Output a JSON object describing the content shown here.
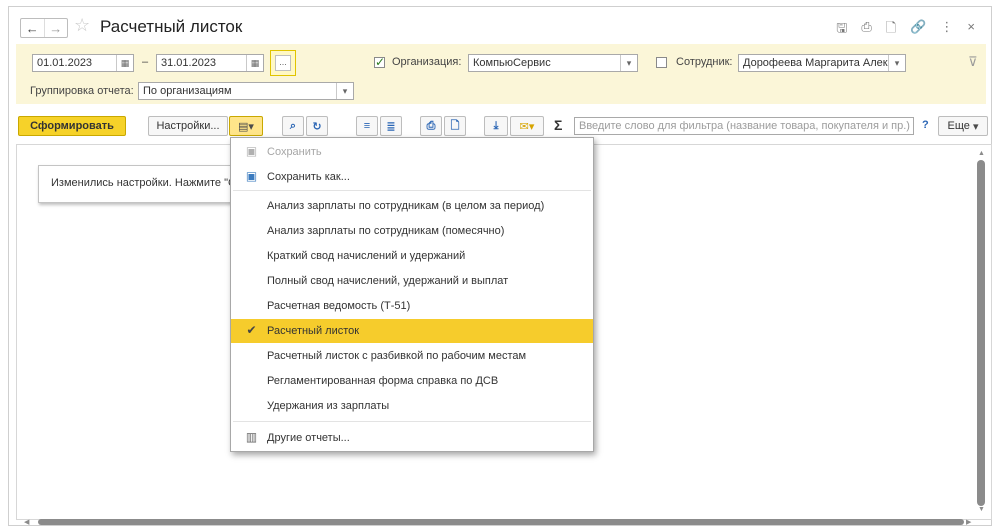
{
  "window": {
    "title": "Расчетный листок",
    "nav_back": "←",
    "nav_forward": "→",
    "star": "☆"
  },
  "title_icons": [
    "save-icon",
    "print-icon",
    "preview-icon",
    "link-icon",
    "more-vertical-icon",
    "close-icon"
  ],
  "title_icon_glyphs": [
    "🖫",
    "⎙",
    "🗋",
    "🔗",
    "⋮",
    "×"
  ],
  "filters": {
    "date_from": "01.01.2023",
    "date_dash": "–",
    "date_to": "31.01.2023",
    "period_button": "...",
    "org_label": "Организация:",
    "org_value": "КомпьюСервис",
    "employee_label": "Сотрудник:",
    "employee_value": "Дорофеева Маргарита Алек",
    "grouping_label": "Группировка отчета:",
    "grouping_value": "По организациям",
    "org_checked": true,
    "employee_checked": false
  },
  "toolbar": {
    "generate": "Сформировать",
    "settings": "Настройки...",
    "filter_placeholder": "Введите слово для фильтра (название товара, покупателя и пр.)",
    "help": "?",
    "more": "Еще",
    "sigma": "Σ"
  },
  "notice": {
    "text": "Изменились настройки. Нажмите \"С"
  },
  "menu": {
    "items": [
      {
        "label": "Сохранить",
        "icon": "save-icon",
        "disabled": true
      },
      {
        "label": "Сохранить как...",
        "icon": "save-as-icon"
      },
      {
        "label": "Анализ зарплаты по сотрудникам (в целом за период)"
      },
      {
        "label": "Анализ зарплаты по сотрудникам (помесячно)"
      },
      {
        "label": "Краткий свод начислений и удержаний"
      },
      {
        "label": "Полный свод начислений, удержаний и выплат"
      },
      {
        "label": "Расчетная ведомость (Т-51)"
      },
      {
        "label": "Расчетный листок",
        "selected": true,
        "icon": "checkmark-icon"
      },
      {
        "label": "Расчетный листок с разбивкой по рабочим местам"
      },
      {
        "label": "Регламентированная форма справка по ДСВ"
      },
      {
        "label": "Удержания из зарплаты"
      },
      {
        "label": "Другие отчеты...",
        "icon": "reports-icon"
      }
    ]
  },
  "colors": {
    "accent": "#f6d229",
    "selected": "#f6cc2c",
    "filter_bg": "#fbf6d8"
  }
}
